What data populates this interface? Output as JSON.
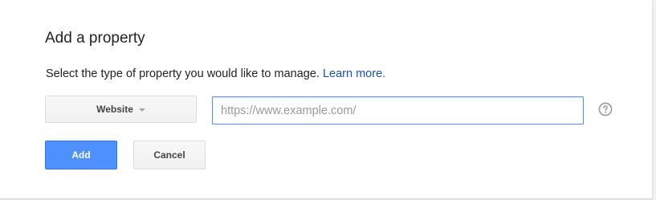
{
  "dialog": {
    "title": "Add a property",
    "description": "Select the type of property you would like to manage.",
    "learn_more_label": "Learn more."
  },
  "property_type": {
    "selected": "Website",
    "icon": "caret-down-icon"
  },
  "url_field": {
    "value": "",
    "placeholder": "https://www.example.com/"
  },
  "help": {
    "icon": "help-icon"
  },
  "actions": {
    "add_label": "Add",
    "cancel_label": "Cancel"
  },
  "colors": {
    "primary_button": "#4d90fe",
    "link": "#1a4fba",
    "input_focus_border": "#4d90fe"
  }
}
